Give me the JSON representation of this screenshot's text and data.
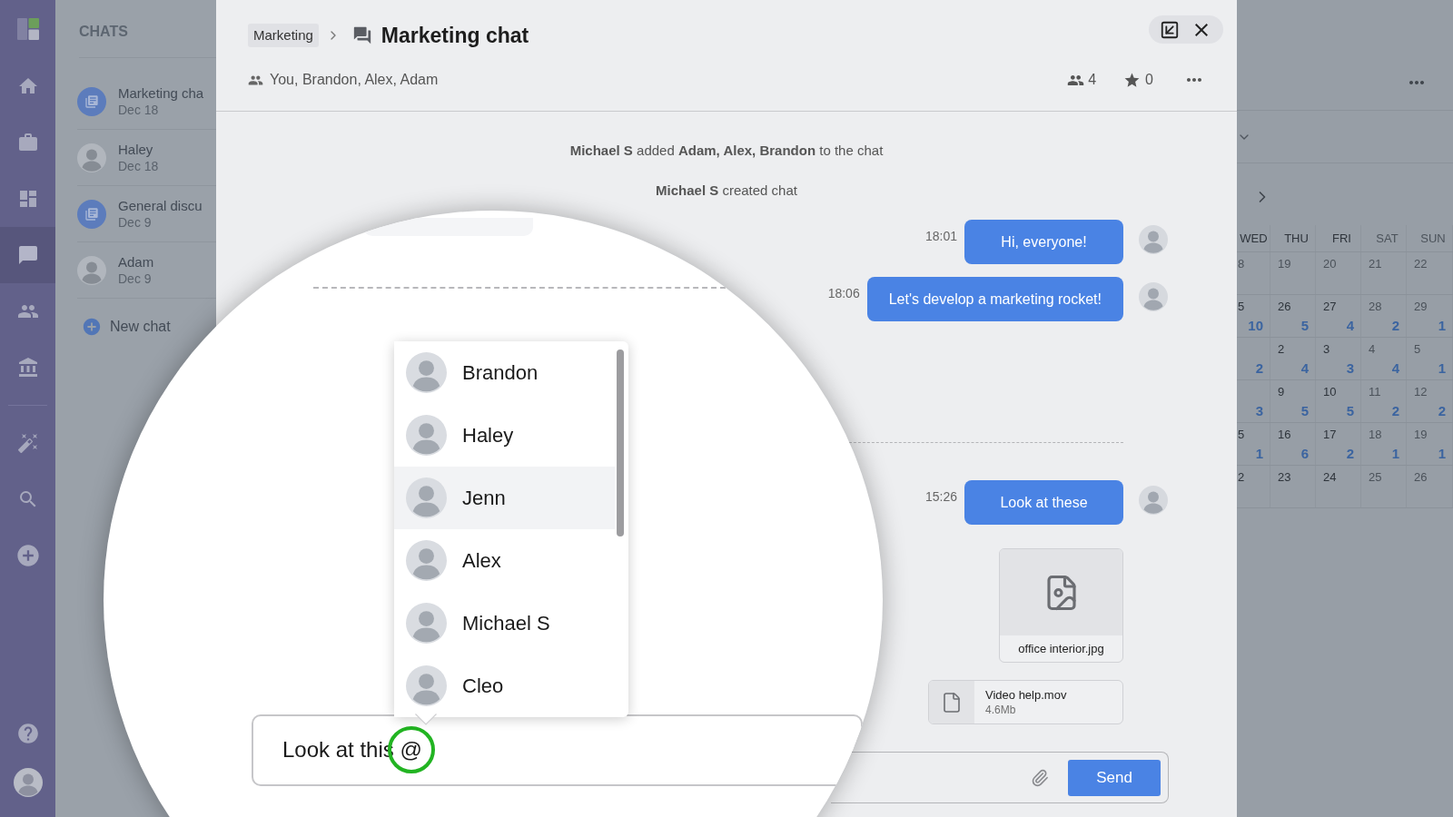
{
  "rail": {
    "items": [
      {
        "selected": false
      },
      {
        "selected": false
      },
      {
        "selected": false
      },
      {
        "selected": true
      },
      {
        "selected": false
      },
      {
        "selected": false
      }
    ]
  },
  "chats_panel": {
    "title": "CHATS",
    "chats": [
      {
        "kind": "group",
        "name": "Marketing cha",
        "date": "Dec 18"
      },
      {
        "kind": "person",
        "name": "Haley",
        "date": "Dec 18"
      },
      {
        "kind": "group",
        "name": "General discu",
        "date": "Dec 9"
      },
      {
        "kind": "person",
        "name": "Adam",
        "date": "Dec 9"
      }
    ],
    "new_chat": "New chat"
  },
  "chat": {
    "breadcrumb": "Marketing",
    "title": "Marketing chat",
    "participants": "You, Brandon, Alex, Adam",
    "member_count": "4",
    "star_count": "0",
    "events": [
      "**Michael S** added **Adam, Alex, Brandon** to the chat",
      "**Michael S** created chat"
    ],
    "message_groups": [
      {
        "messages": [
          {
            "time": "18:01",
            "text": "Hi, everyone!"
          },
          {
            "time": "18:06",
            "text": "Let's develop a marketing rocket!"
          }
        ]
      },
      {
        "messages": [
          {
            "time": "15:26",
            "text": "Look at these"
          }
        ],
        "attachments": [
          {
            "kind": "image",
            "name": "office interior.jpg"
          },
          {
            "kind": "file",
            "name": "Video help.mov",
            "size": "4.6Mb"
          }
        ]
      }
    ],
    "composer": {
      "send_label": "Send"
    }
  },
  "calendar": {
    "weekdays": [
      {
        "label": "WED",
        "muted": false
      },
      {
        "label": "THU",
        "muted": false
      },
      {
        "label": "FRI",
        "muted": false
      },
      {
        "label": "SAT",
        "muted": true
      },
      {
        "label": "SUN",
        "muted": true
      }
    ],
    "weeks": [
      {
        "days": [
          {
            "day": "8",
            "muted": true
          },
          {
            "day": "19",
            "muted": true
          },
          {
            "day": "20",
            "muted": true
          },
          {
            "day": "21",
            "muted": true
          },
          {
            "day": "22",
            "muted": true
          }
        ]
      },
      {
        "days": [
          {
            "day": "5",
            "count": "10",
            "muted": false
          },
          {
            "day": "26",
            "count": "5",
            "muted": false
          },
          {
            "day": "27",
            "count": "4",
            "muted": false
          },
          {
            "day": "28",
            "count": "2",
            "muted": true
          },
          {
            "day": "29",
            "count": "1",
            "muted": true
          }
        ]
      },
      {
        "days": [
          {
            "count": "2"
          },
          {
            "day": "2",
            "count": "4",
            "muted": false
          },
          {
            "day": "3",
            "count": "3",
            "muted": false
          },
          {
            "day": "4",
            "count": "4",
            "muted": true
          },
          {
            "day": "5",
            "count": "1",
            "muted": true
          }
        ]
      },
      {
        "days": [
          {
            "count": "3"
          },
          {
            "day": "9",
            "count": "5",
            "muted": false
          },
          {
            "day": "10",
            "count": "5",
            "muted": false
          },
          {
            "day": "11",
            "count": "2",
            "muted": true
          },
          {
            "day": "12",
            "count": "2",
            "muted": true
          }
        ]
      },
      {
        "days": [
          {
            "day": "5",
            "count": "1",
            "muted": false
          },
          {
            "day": "16",
            "count": "6",
            "muted": false
          },
          {
            "day": "17",
            "count": "2",
            "muted": false
          },
          {
            "day": "18",
            "count": "1",
            "muted": true
          },
          {
            "day": "19",
            "count": "1",
            "muted": true
          }
        ]
      },
      {
        "days": [
          {
            "day": "2",
            "muted": false
          },
          {
            "day": "23",
            "muted": false
          },
          {
            "day": "24",
            "muted": false
          },
          {
            "day": "25",
            "muted": true
          },
          {
            "day": "26",
            "muted": true
          }
        ]
      }
    ]
  },
  "magnifier": {
    "mention_options": [
      {
        "name": "Brandon",
        "selected": false
      },
      {
        "name": "Haley",
        "selected": false
      },
      {
        "name": "Jenn",
        "selected": true
      },
      {
        "name": "Alex",
        "selected": false
      },
      {
        "name": "Michael S",
        "selected": false
      },
      {
        "name": "Cleo",
        "selected": false
      }
    ],
    "input_value": "Look at this @"
  }
}
